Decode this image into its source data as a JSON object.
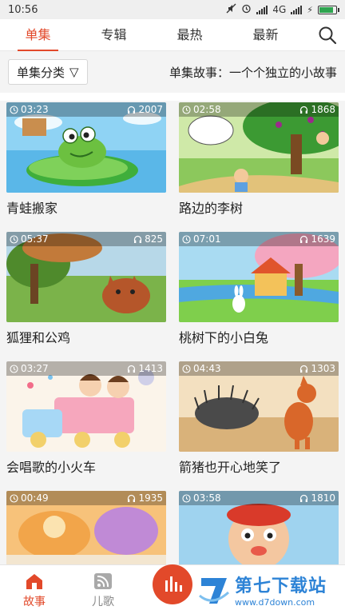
{
  "status_bar": {
    "time": "10:56",
    "network": "4G",
    "battery_level": 0.9
  },
  "tabs": [
    {
      "label": "单集",
      "active": true
    },
    {
      "label": "专辑",
      "active": false
    },
    {
      "label": "最热",
      "active": false
    },
    {
      "label": "最新",
      "active": false
    }
  ],
  "icons": {
    "search": "search-icon",
    "clock": "clock-icon",
    "headphones": "headphones-icon"
  },
  "filter": {
    "category_label": "单集分类",
    "dropdown_glyph": "▽",
    "description": "单集故事：一个个独立的小故事"
  },
  "stories": [
    {
      "title": "青蛙搬家",
      "duration": "03:23",
      "plays": "2007"
    },
    {
      "title": "路边的李树",
      "duration": "02:58",
      "plays": "1868"
    },
    {
      "title": "狐狸和公鸡",
      "duration": "05:37",
      "plays": "825"
    },
    {
      "title": "桃树下的小白兔",
      "duration": "07:01",
      "plays": "1639"
    },
    {
      "title": "会唱歌的小火车",
      "duration": "03:27",
      "plays": "1413"
    },
    {
      "title": "箭猪也开心地笑了",
      "duration": "04:43",
      "plays": "1303"
    },
    {
      "title": "",
      "duration": "00:49",
      "plays": "1935"
    },
    {
      "title": "",
      "duration": "03:58",
      "plays": "1810"
    }
  ],
  "bottom_nav": [
    {
      "label": "故事",
      "active": true
    },
    {
      "label": "儿歌",
      "active": false
    }
  ],
  "watermark": {
    "name": "第七下载站",
    "url": "www.d7down.com"
  },
  "colors": {
    "accent": "#e2492a",
    "watermark": "#2d83d6"
  }
}
